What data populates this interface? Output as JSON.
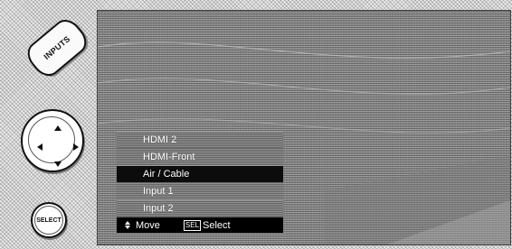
{
  "remote": {
    "inputs_label": "INPUTS",
    "select_label": "SELECT",
    "icons": [
      "inputs-button",
      "dpad-up",
      "dpad-down",
      "dpad-left",
      "dpad-right",
      "select-button"
    ]
  },
  "menu": {
    "items": [
      {
        "label": "HDMI 2",
        "selected": false
      },
      {
        "label": "HDMI-Front",
        "selected": false
      },
      {
        "label": "Air / Cable",
        "selected": true
      },
      {
        "label": "Input 1",
        "selected": false
      },
      {
        "label": "Input 2",
        "selected": false
      }
    ],
    "footer": {
      "move_label": "Move",
      "sel_key": "SEL",
      "select_label": "Select"
    }
  },
  "colors": {
    "menu_selected_bg": "#0c0c0c",
    "menu_item_bg": "#8e8e8e",
    "footer_bg": "#000000",
    "menu_text": "#ffffff"
  }
}
